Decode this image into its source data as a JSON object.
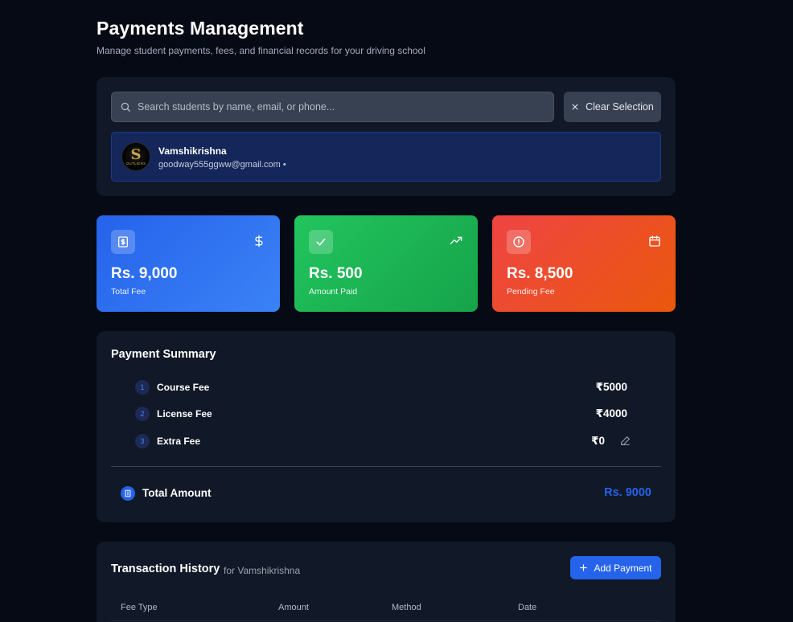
{
  "header": {
    "title": "Payments Management",
    "subtitle": "Manage student payments, fees, and financial records for your driving school"
  },
  "search": {
    "placeholder": "Search students by name, email, or phone...",
    "clear_label": "Clear Selection"
  },
  "student": {
    "name": "Vamshikrishna",
    "email": "goodway555ggww@gmail.com •",
    "avatar_letter": "S",
    "avatar_text": "OUTLIERS"
  },
  "stats": [
    {
      "value": "Rs. 9,000",
      "label": "Total Fee",
      "icon": "receipt-icon",
      "right_icon": "dollar-icon"
    },
    {
      "value": "Rs. 500",
      "label": "Amount Paid",
      "icon": "check-icon",
      "right_icon": "trending-up-icon"
    },
    {
      "value": "Rs. 8,500",
      "label": "Pending Fee",
      "icon": "alert-circle-icon",
      "right_icon": "calendar-icon"
    }
  ],
  "summary": {
    "title": "Payment Summary",
    "items": [
      {
        "num": "1",
        "name": "Course Fee",
        "amount": "₹5000"
      },
      {
        "num": "2",
        "name": "License Fee",
        "amount": "₹4000"
      },
      {
        "num": "3",
        "name": "Extra Fee",
        "amount": "₹0"
      }
    ],
    "total_label": "Total Amount",
    "total_amount": "Rs. 9000"
  },
  "transactions": {
    "title": "Transaction History",
    "for_text": "for Vamshikrishna",
    "add_label": "Add Payment",
    "columns": [
      "Fee Type",
      "Amount",
      "Method",
      "Date"
    ]
  },
  "colors": {
    "background": "#050a14",
    "card": "#111827",
    "accent": "#2563eb",
    "success": "#22c55e",
    "danger": "#ef4444"
  }
}
